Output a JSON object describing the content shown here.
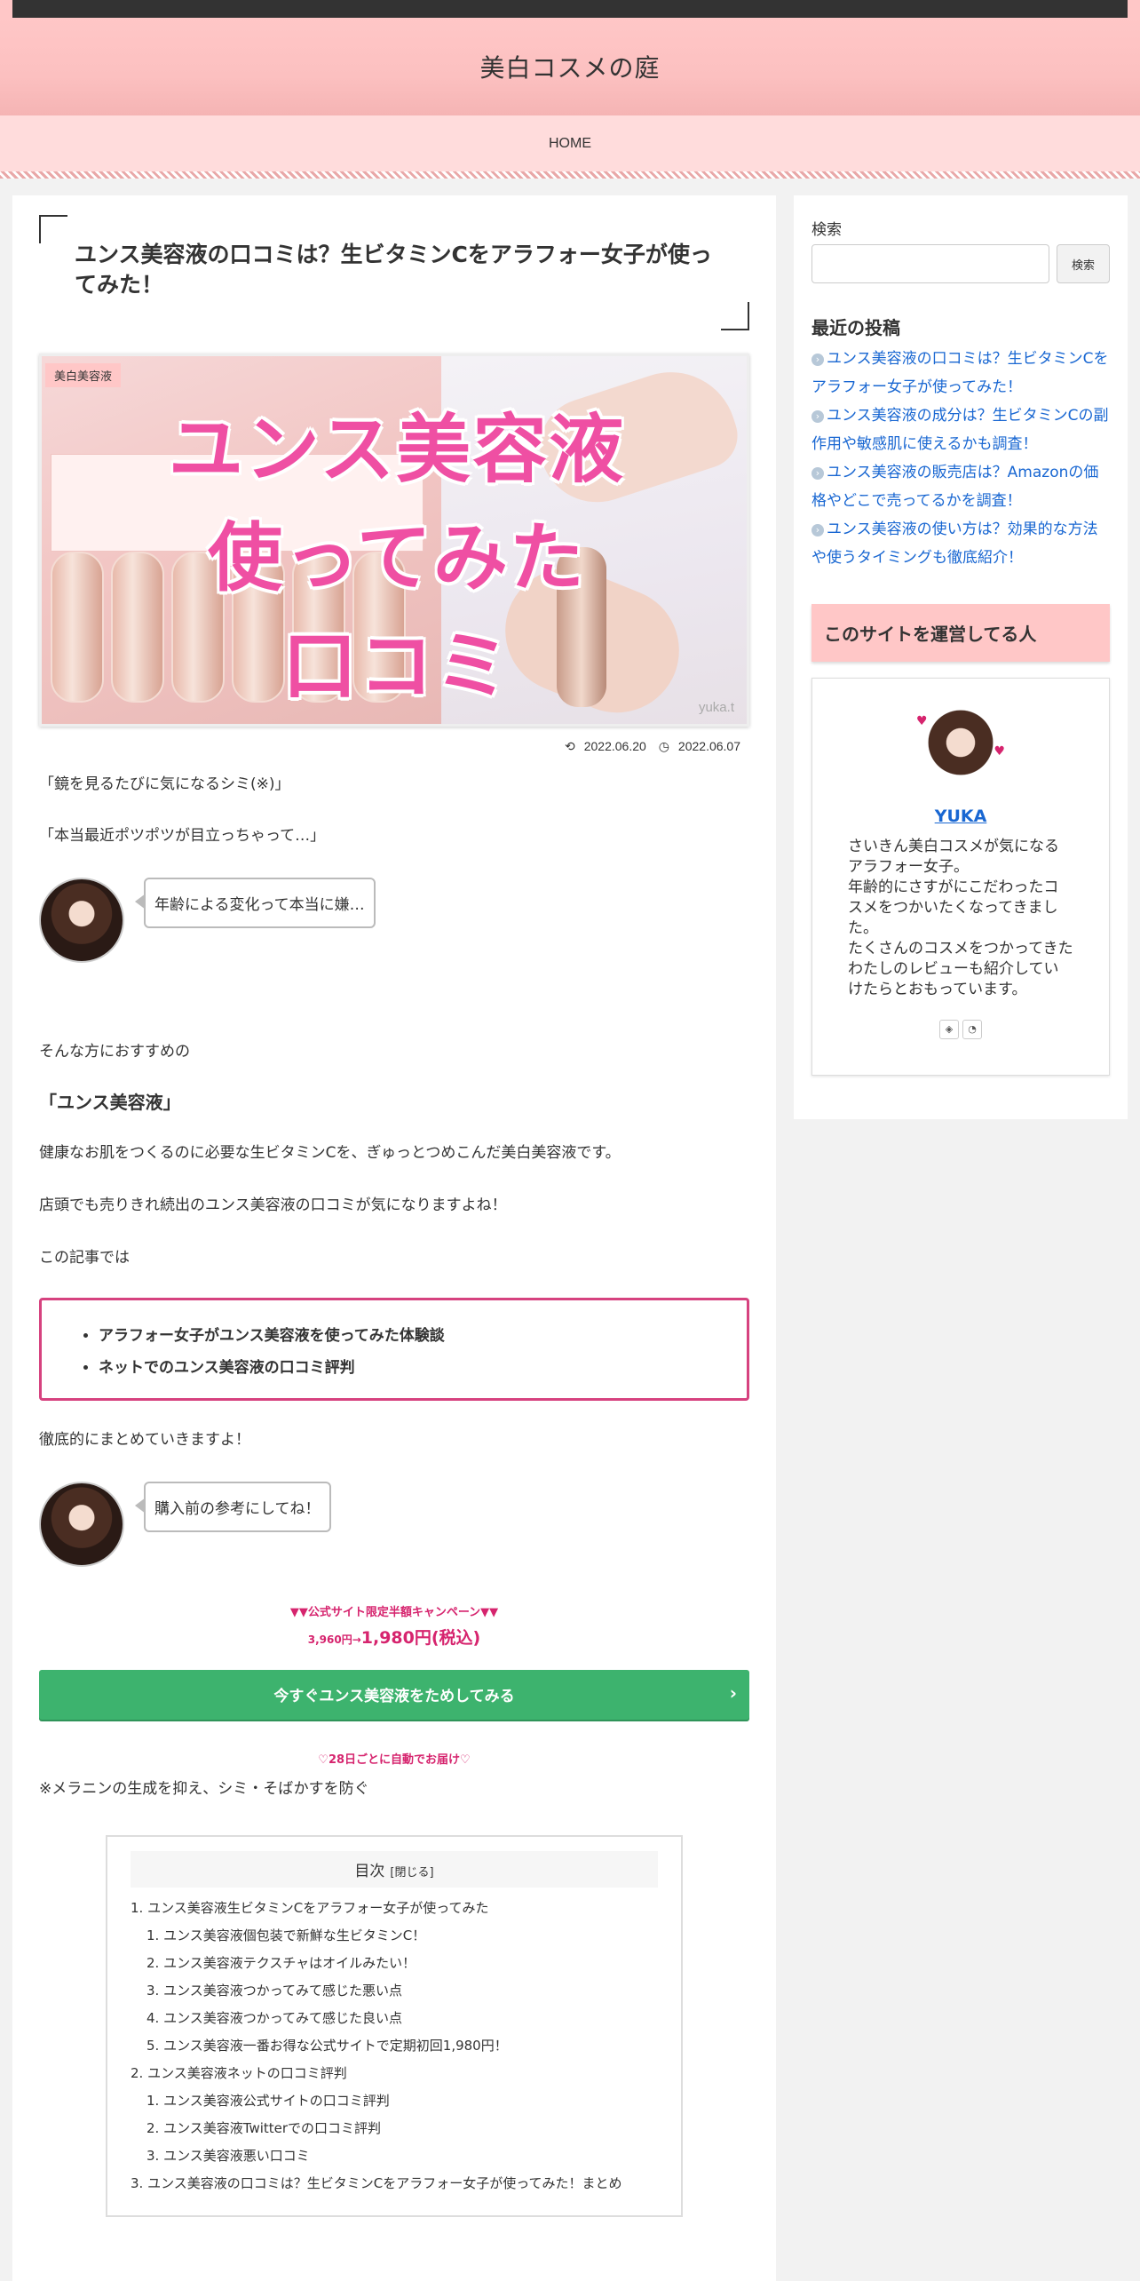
{
  "site": {
    "title": "美白コスメの庭"
  },
  "nav": {
    "items": [
      {
        "label": "HOME"
      }
    ]
  },
  "article": {
    "title": "ユンス美容液の口コミは？生ビタミンCをアラフォー女子が使ってみた！",
    "category": "美白美容液",
    "eyecatch": {
      "line1": "ユンス美容液",
      "line2": "使ってみた",
      "line3": "口コミ",
      "credit": "yuka.t"
    },
    "published": "2022.06.20",
    "updated": "2022.06.07",
    "para1": "「鏡を見るたびに気になるシミ(※)」",
    "para2": "「本当最近ポツポツが目立っちゃって…」",
    "bubble1": "年齢による変化って本当に嫌…",
    "para3": "そんな方におすすめの",
    "catch": "「ユンス美容液」",
    "para4": "健康なお肌をつくるのに必要な生ビタミンCを、ぎゅっとつめこんだ美白美容液です。",
    "para5": "店頭でも売りきれ続出のユンス美容液の口コミが気になりますよね！",
    "para6": "この記事では",
    "points": [
      "アラフォー女子がユンス美容液を使ってみた体験談",
      "ネットでのユンス美容液の口コミ評判"
    ],
    "para7": "徹底的にまとめていきますよ！",
    "bubble2": "購入前の参考にしてね！",
    "campaign": {
      "headline": "▼▼公式サイト限定半額キャンペーン▼▼",
      "old_price": "3,960円→",
      "new_price": "1,980円(税込)"
    },
    "cta": {
      "label": "今すぐユンス美容液をためしてみる",
      "arrow": "›"
    },
    "auto_delivery": "♡28日ごとに自動でお届け♡",
    "note": "※メラニンの生成を抑え、シミ・そばかすを防ぐ",
    "toc": {
      "title": "目次",
      "toggle": "[閉じる]",
      "items": [
        "1. ユンス美容液生ビタミンCをアラフォー女子が使ってみた",
        "1. ユンス美容液個包装で新鮮な生ビタミンC！",
        "2. ユンス美容液テクスチャはオイルみたい！",
        "3. ユンス美容液つかってみて感じた悪い点",
        "4. ユンス美容液つかってみて感じた良い点",
        "5. ユンス美容液一番お得な公式サイトで定期初回1,980円！",
        "2. ユンス美容液ネットの口コミ評判",
        "1. ユンス美容液公式サイトの口コミ評判",
        "2. ユンス美容液Twitterでの口コミ評判",
        "3. ユンス美容液悪い口コミ",
        "3. ユンス美容液の口コミは？生ビタミンCをアラフォー女子が使ってみた！まとめ"
      ]
    }
  },
  "sidebar": {
    "search_label": "検索",
    "search_button": "検索",
    "search_value": "",
    "recent_title": "最近の投稿",
    "recent": [
      "ユンス美容液の口コミは？生ビタミンCをアラフォー女子が使ってみた！",
      "ユンス美容液の成分は？生ビタミンCの副作用や敏感肌に使えるかも調査！",
      "ユンス美容液の販売店は？Amazonの価格やどこで売ってるかを調査！",
      "ユンス美容液の使い方は？効果的な方法や使うタイミングも徹底紹介！"
    ],
    "owner_title": "このサイトを運営してる人",
    "profile": {
      "name": "YUKA",
      "bio": "さいきん美白コスメが気になるアラフォー女子。\n年齢的にさすがにこだわったコスメをつかいたくなってきました。\nたくさんのコスメをつかってきたわたしのレビューも紹介していけたらとおもっています。"
    }
  },
  "colors": {
    "accent": "#ffc7c7",
    "cta": "#3db36e",
    "campaign": "#d6246e",
    "pointbox": "#d6427f",
    "link": "#1967d2"
  },
  "icons": {
    "published": "refresh-icon",
    "updated": "clock-icon",
    "recent_bullet": "chevron-right-icon",
    "profile_1": "feedly-icon",
    "profile_2": "rss-icon"
  }
}
